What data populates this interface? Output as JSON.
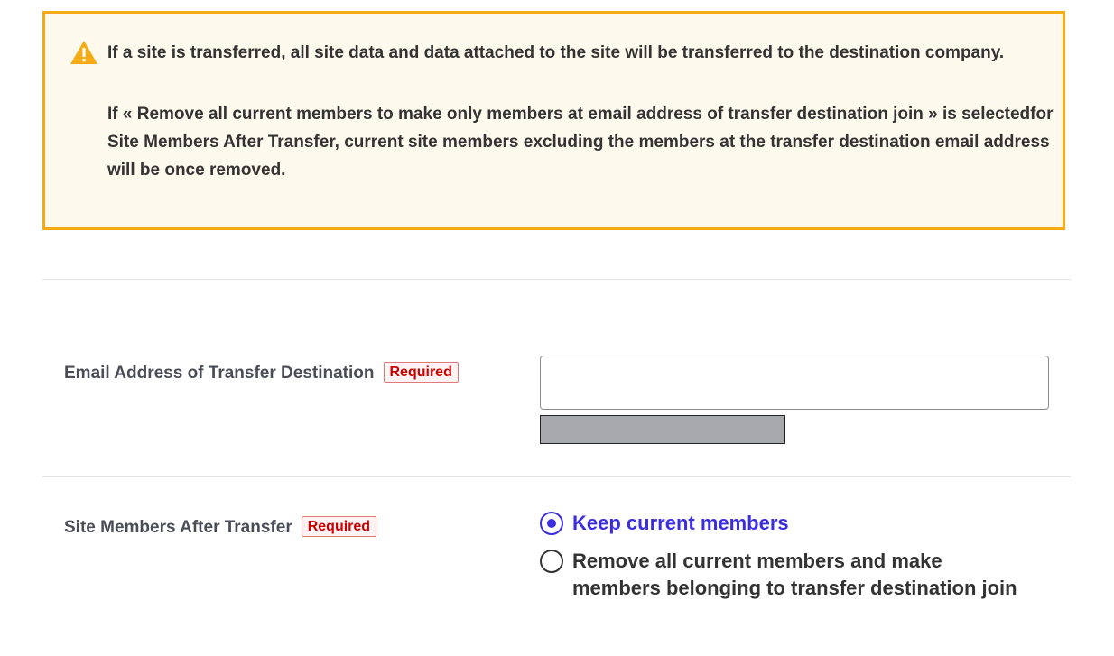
{
  "alert": {
    "icon": "warning-triangle-icon",
    "paragraph_1": "If a site is transferred, all site data and data attached to the site will be transferred to the destination company.",
    "paragraph_2": "If « Remove all current members to make only members at email address of transfer destination join » is selectedfor Site Members After Transfer, current site members excluding the members at the transfer destination email address will be once removed.",
    "colors": {
      "border": "#f5ab14",
      "background": "#fef9ed"
    }
  },
  "email_field": {
    "label": "Email Address of Transfer Destination",
    "required_badge": "Required",
    "value": "",
    "placeholder": ""
  },
  "members_field": {
    "label": "Site Members After Transfer",
    "required_badge": "Required",
    "options": [
      {
        "label": "Keep current members",
        "selected": true
      },
      {
        "label": "Remove all current members and make members belonging to transfer destination join",
        "selected": false
      }
    ]
  },
  "colors": {
    "accent": "#3a2ee0",
    "required": "#cc0000"
  }
}
